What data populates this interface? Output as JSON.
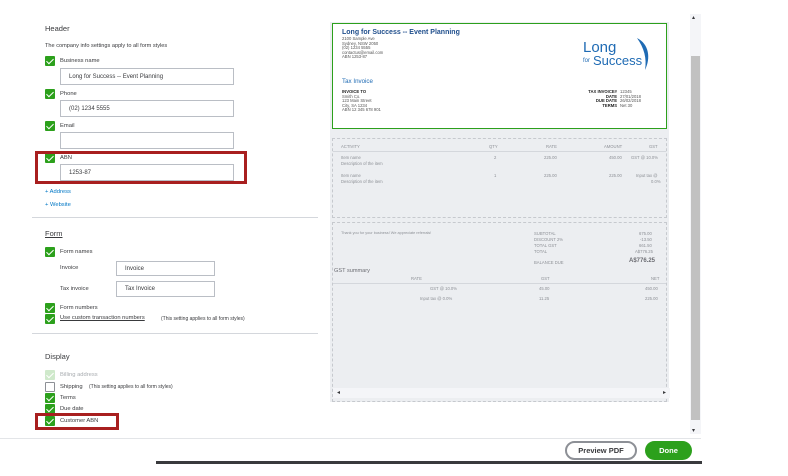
{
  "header": {
    "title": "Header",
    "description": "The company info settings apply to all form styles",
    "business_name_label": "Business name",
    "business_name_value": "Long for Success -- Event Planning",
    "phone_label": "Phone",
    "phone_value": "(02) 1234 5555",
    "email_label": "Email",
    "email_value": "",
    "abn_label": "ABN",
    "abn_value": "1253-87",
    "add_address": "+ Address",
    "add_website": "+ Website"
  },
  "form": {
    "title": "Form",
    "form_names_label": "Form names",
    "invoice_label": "Invoice",
    "invoice_value": "Invoice",
    "tax_invoice_label": "Tax invoice",
    "tax_invoice_value": "Tax Invoice",
    "form_numbers_label": "Form numbers",
    "custom_numbers_label": "Use custom transaction numbers",
    "custom_numbers_note": "(This setting applies to all form styles)"
  },
  "display": {
    "title": "Display",
    "billing_address_label": "Billing address",
    "shipping_label": "Shipping",
    "shipping_note": "(This setting applies to all form styles)",
    "terms_label": "Terms",
    "due_date_label": "Due date",
    "customer_abn_label": "Customer ABN"
  },
  "preview": {
    "company_name": "Long for Success -- Event Planning",
    "company_address": [
      "2100 Sample Ave",
      "Sydney, NSW 2050",
      "(02) 1234 5555",
      "contactus@email.com",
      "ABN 1253-87"
    ],
    "logo_text_1": "Long",
    "logo_text_2": "for",
    "logo_text_3": "Success",
    "invoice_title": "Tax Invoice",
    "invoice_to_label": "INVOICE TO",
    "invoice_to": [
      "Smith Co.",
      "123 Main Street",
      "City, SA 1234",
      "ABN 12 345 678 901"
    ],
    "meta": [
      {
        "k": "TAX INVOICE#",
        "v": "12345"
      },
      {
        "k": "DATE",
        "v": "27/01/2018"
      },
      {
        "k": "DUE DATE",
        "v": "26/02/2018"
      },
      {
        "k": "TERMS",
        "v": "Net 30"
      }
    ],
    "columns": [
      "ACTIVITY",
      "QTY",
      "RATE",
      "AMOUNT",
      "GST"
    ],
    "rows": [
      {
        "name": "Item name",
        "desc": "Description of the item",
        "qty": "2",
        "rate": "225.00",
        "amount": "450.00",
        "gst": "GST @ 10.0%"
      },
      {
        "name": "Item name",
        "desc": "Description of the item",
        "qty": "1",
        "rate": "225.00",
        "amount": "225.00",
        "gst": "Input tax @",
        "gst2": "0.0%"
      }
    ],
    "thanks": "Thank you for your business! We appreciate referrals!",
    "totals": [
      {
        "k": "SUBTOTAL",
        "v": "675.00"
      },
      {
        "k": "DISCOUNT 2%",
        "v": "-13.50"
      },
      {
        "k": "TOTAL GST",
        "v": "661.50"
      },
      {
        "k": "TOTAL",
        "v": "A$776.25"
      }
    ],
    "balance_due_label": "BALANCE DUE",
    "balance_due_value": "A$776.25",
    "gst_summary_title": "GST summary",
    "gst_columns": [
      "RATE",
      "GST",
      "NET"
    ],
    "gst_rows": [
      {
        "rate": "GST @ 10.0%",
        "gst": "45.00",
        "net": "450.00"
      },
      {
        "rate": "Input tax @ 0.0%",
        "gst": "11.25",
        "net": "225.00"
      }
    ]
  },
  "footer": {
    "preview_pdf": "Preview PDF",
    "done": "Done"
  },
  "colors": {
    "accent_green": "#2ca01c",
    "highlight_red": "#a81f1f",
    "link_blue": "#0077c5"
  }
}
